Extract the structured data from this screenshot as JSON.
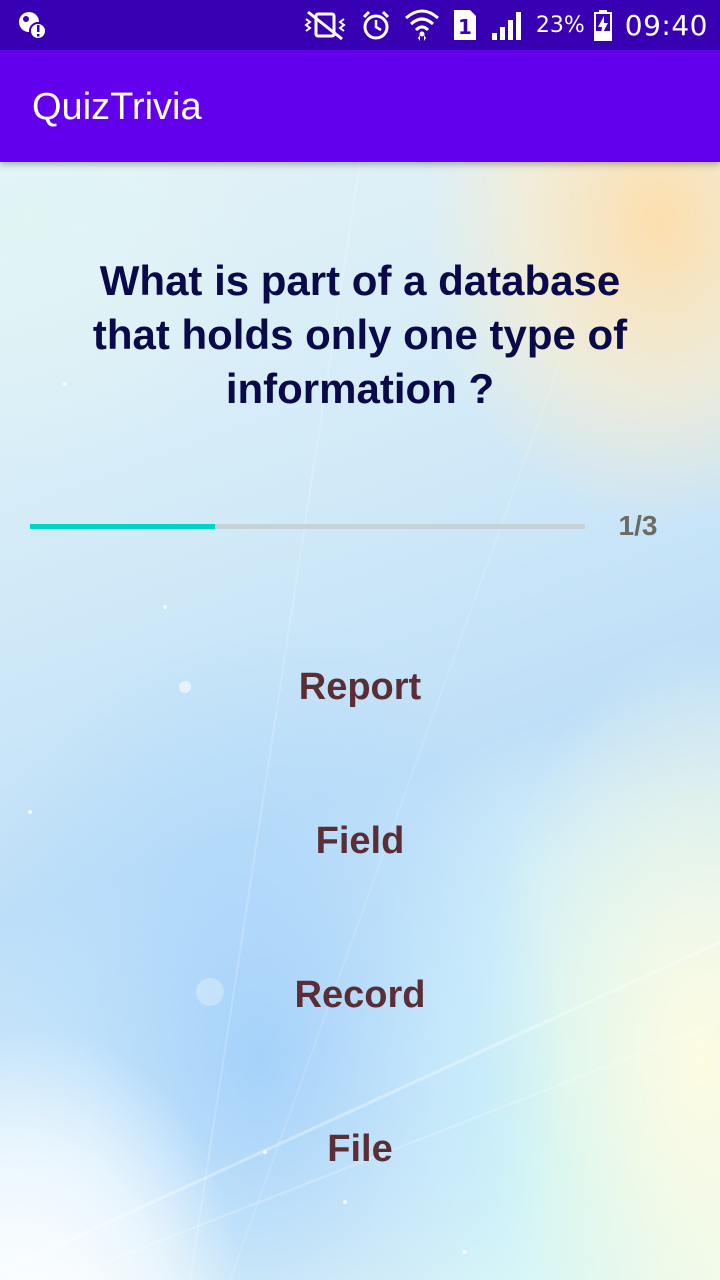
{
  "status_bar": {
    "battery_percent": "23%",
    "time": "09:40",
    "sim_number": "1",
    "icons": [
      "notification-alert-icon",
      "vibrate-mute-icon",
      "alarm-icon",
      "wifi-icon",
      "sim-card-icon",
      "signal-icon",
      "battery-charging-icon"
    ]
  },
  "app_bar": {
    "title": "QuizTrivia",
    "color": "#6200ee"
  },
  "quiz": {
    "question": "What is part of a database that holds only one type of information ?",
    "progress": {
      "text": "1/3",
      "current": 1,
      "total": 3,
      "fraction": 0.333
    },
    "options": [
      "Report",
      "Field",
      "Record",
      "File"
    ]
  },
  "colors": {
    "status_bar": "#3700b3",
    "question_text": "#0a0a4a",
    "option_text": "#5b2e36",
    "progress_fill": "#00d4c8",
    "progress_track": "#c7d2d6"
  }
}
